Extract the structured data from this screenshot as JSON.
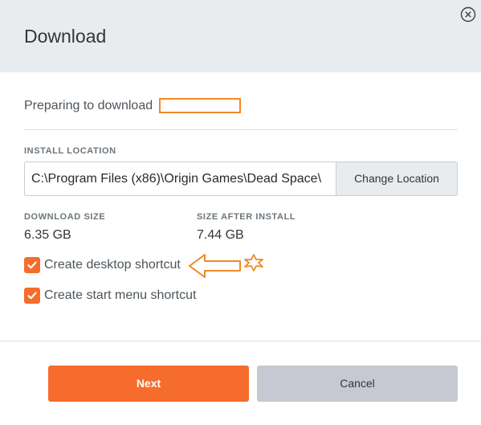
{
  "dialog": {
    "title": "Download",
    "close_icon": "circle-x-icon"
  },
  "status": {
    "preparing_text": "Preparing to download"
  },
  "install": {
    "label": "INSTALL LOCATION",
    "path": "C:\\Program Files (x86)\\Origin Games\\Dead Space\\",
    "change_button": "Change Location"
  },
  "sizes": {
    "download_label": "DOWNLOAD SIZE",
    "download_value": "6.35 GB",
    "after_install_label": "SIZE AFTER INSTALL",
    "after_install_value": "7.44 GB"
  },
  "options": [
    {
      "label": "Create desktop shortcut",
      "checked": true
    },
    {
      "label": "Create start menu shortcut",
      "checked": true
    }
  ],
  "buttons": {
    "next": "Next",
    "cancel": "Cancel"
  },
  "colors": {
    "accent": "#f56c2d",
    "annotation": "#f08a24",
    "header_bg": "#e8ecee",
    "cancel_bg": "#c6c9d1"
  }
}
